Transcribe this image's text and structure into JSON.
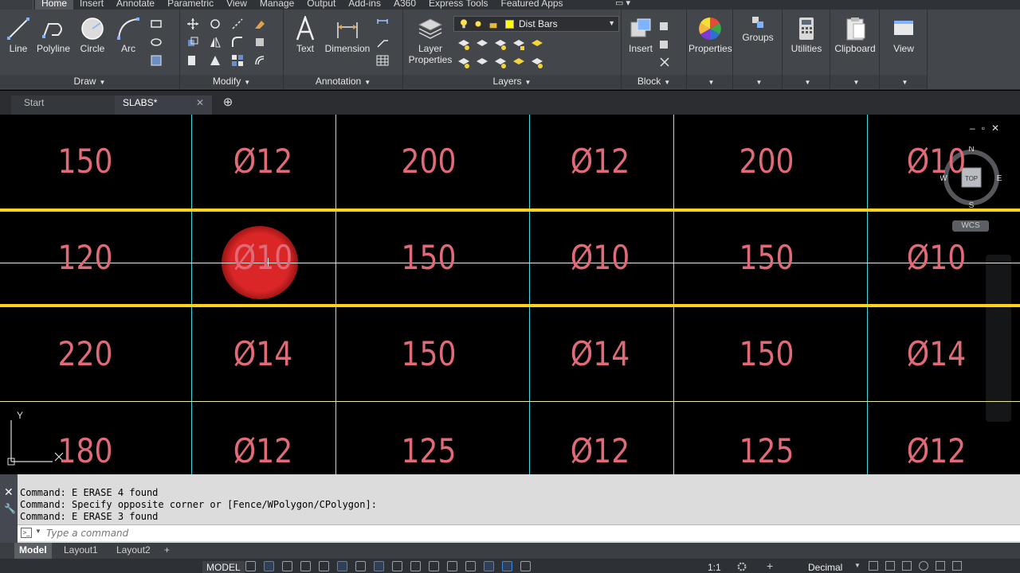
{
  "ribbon_tabs": [
    "Home",
    "Insert",
    "Annotate",
    "Parametric",
    "View",
    "Manage",
    "Output",
    "Add-ins",
    "A360",
    "Express Tools",
    "Featured Apps"
  ],
  "active_tab": "Home",
  "draw_panel": {
    "title": "Draw",
    "tools": [
      "Line",
      "Polyline",
      "Circle",
      "Arc"
    ]
  },
  "modify_panel": {
    "title": "Modify"
  },
  "annotation_panel": {
    "title": "Annotation",
    "tools": [
      "Text",
      "Dimension"
    ]
  },
  "layers_panel": {
    "title": "Layers",
    "layer_properties": "Layer\nProperties",
    "current_layer": "Dist Bars",
    "current_layer_color": "#ffff00"
  },
  "block_panel": {
    "title": "Block",
    "insert": "Insert"
  },
  "right_tools": [
    "Properties",
    "Groups",
    "Utilities",
    "Clipboard",
    "View"
  ],
  "file_tabs": [
    {
      "label": "Start"
    },
    {
      "label": "SLABS*"
    }
  ],
  "drawing": {
    "rows": [
      [
        "150",
        "Ø12",
        "200",
        "Ø12",
        "200",
        "Ø10"
      ],
      [
        "120",
        "Ø10",
        "150",
        "Ø10",
        "150",
        "Ø10"
      ],
      [
        "220",
        "Ø14",
        "150",
        "Ø14",
        "150",
        "Ø14"
      ],
      [
        "180",
        "Ø12",
        "125",
        "Ø12",
        "125",
        "Ø12"
      ]
    ],
    "text_color": "#e06a78",
    "grid_cyan": "#3fd7e0",
    "grid_yellow": "#f2d44a",
    "band_color": "#ffd21e"
  },
  "viewcube": {
    "top": "TOP",
    "n": "N",
    "s": "S",
    "e": "E",
    "w": "W",
    "wcs": "WCS"
  },
  "ucs": {
    "y": "Y"
  },
  "command_history": [
    "Command: E ERASE 4 found",
    "Command: Specify opposite corner or [Fence/WPolygon/CPolygon]:",
    "Command: E ERASE 3 found"
  ],
  "command_placeholder": "Type a command",
  "layout_tabs": [
    "Model",
    "Layout1",
    "Layout2"
  ],
  "status": {
    "model": "MODEL",
    "scale": "1:1",
    "units": "Decimal"
  }
}
